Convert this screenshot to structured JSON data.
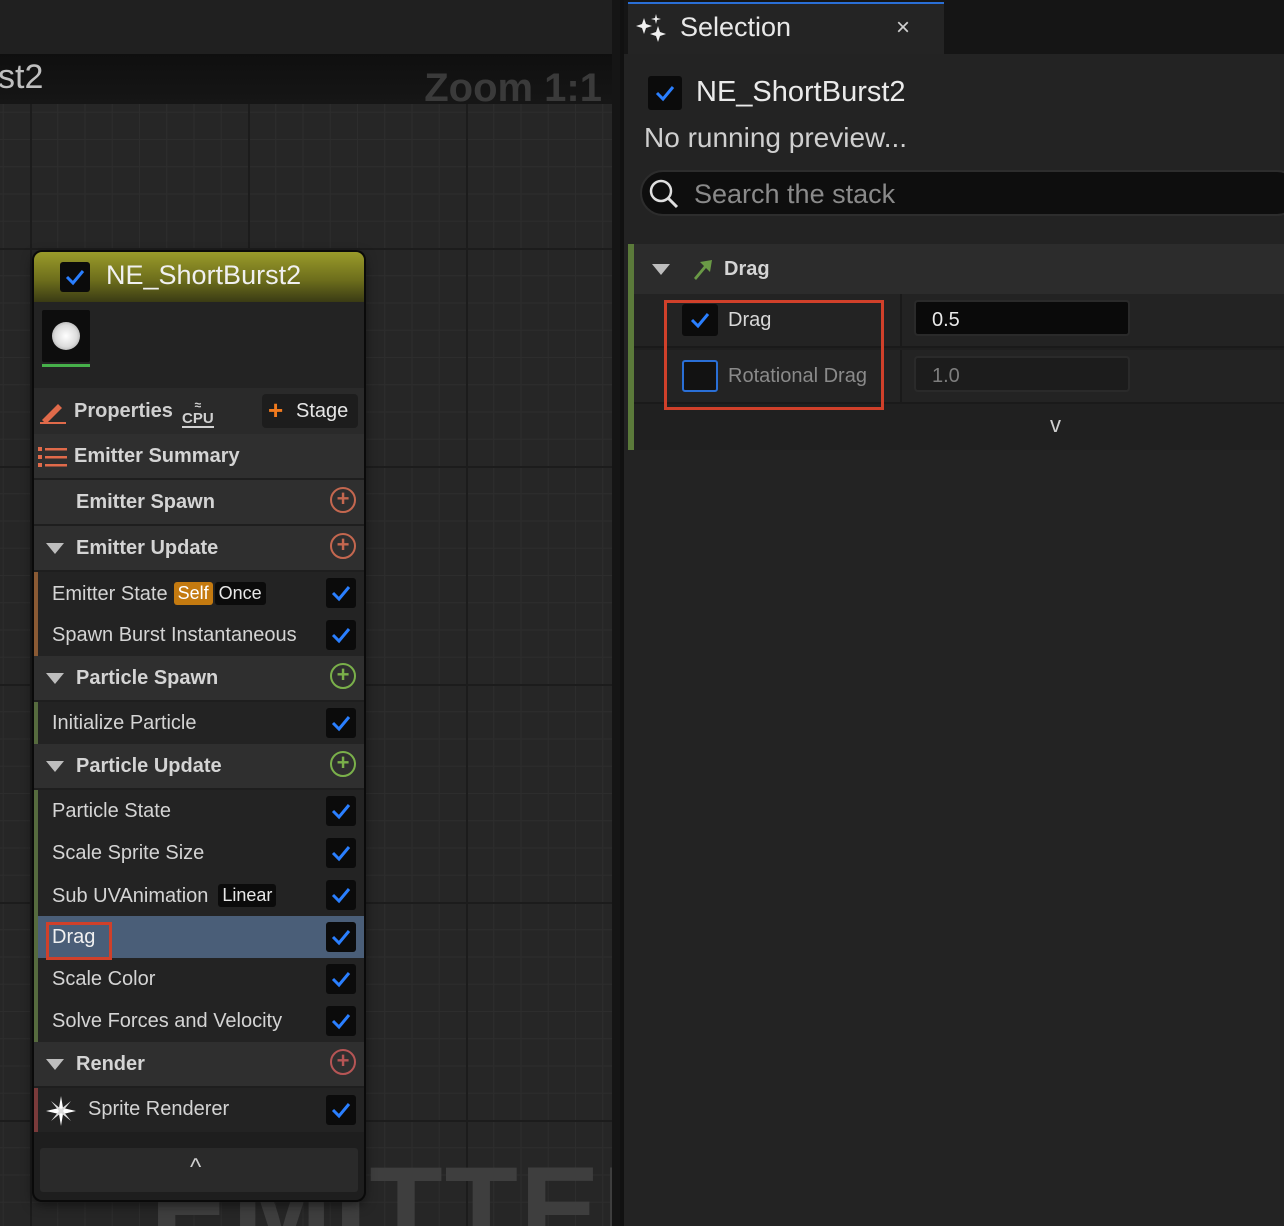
{
  "graph": {
    "title_fragment": "st2",
    "zoom_label": "Zoom 1:1",
    "watermark": "EMITTER"
  },
  "node": {
    "title": "NE_ShortBurst2",
    "enabled": true,
    "properties_label": "Properties",
    "sim_target": "CPU",
    "stage_button": "Stage",
    "summary_label": "Emitter Summary",
    "sections": [
      {
        "label": "Emitter Spawn",
        "collapsible": false,
        "modules": []
      },
      {
        "label": "Emitter Update",
        "collapsible": true,
        "modules": [
          {
            "label": "Emitter State",
            "tags": [
              "Self",
              "Once"
            ],
            "enabled": true
          },
          {
            "label": "Spawn Burst Instantaneous",
            "enabled": true
          }
        ]
      },
      {
        "label": "Particle Spawn",
        "collapsible": true,
        "modules": [
          {
            "label": "Initialize Particle",
            "enabled": true
          }
        ]
      },
      {
        "label": "Particle Update",
        "collapsible": true,
        "modules": [
          {
            "label": "Particle State",
            "enabled": true
          },
          {
            "label": "Scale Sprite Size",
            "enabled": true
          },
          {
            "label": "Sub UVAnimation",
            "tags": [
              "Linear"
            ],
            "enabled": true
          },
          {
            "label": "Drag",
            "enabled": true,
            "selected": true
          },
          {
            "label": "Scale Color",
            "enabled": true
          },
          {
            "label": "Solve Forces and Velocity",
            "enabled": true
          }
        ]
      },
      {
        "label": "Render",
        "collapsible": true,
        "modules": [
          {
            "label": "Sprite Renderer",
            "enabled": true
          }
        ]
      }
    ]
  },
  "panel": {
    "tab_label": "Selection",
    "close_glyph": "×",
    "emitter_name": "NE_ShortBurst2",
    "emitter_enabled": true,
    "status": "No running preview...",
    "search_placeholder": "Search the stack",
    "module": {
      "title": "Drag",
      "params": [
        {
          "label": "Drag",
          "value": "0.5",
          "enabled": true
        },
        {
          "label": "Rotational Drag",
          "value": "1.0",
          "enabled": false
        }
      ],
      "expand_glyph": "v"
    }
  },
  "colors": {
    "accent_blue": "#2a6fd6",
    "highlight_red": "#d0402a",
    "node_header": "#9a9b2a",
    "stage_plus": "#f07a1e"
  },
  "icons": {
    "properties": "pencil-icon",
    "stage": "plus-icon",
    "summary": "list-icon",
    "section_add": "add-circle-icon",
    "renderer": "sparkle-icon",
    "tab": "magic-wand-icon",
    "search": "search-icon",
    "module": "arrow-icon",
    "checkbox": "check-icon"
  }
}
